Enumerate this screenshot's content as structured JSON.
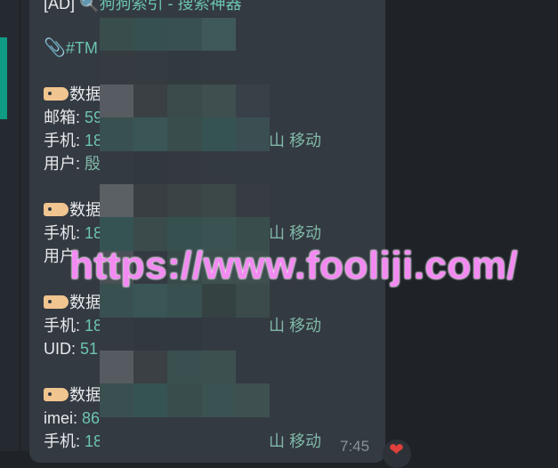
{
  "message": {
    "ad_prefix": "[AD]",
    "ad_icon": "magnifier-icon",
    "ad_link": "狗狗索引 - 搜索神器",
    "hashtag_icon": "paperclip-icon",
    "hashtag": "#TM",
    "records": [
      {
        "title": "数据",
        "rows": [
          {
            "label": "邮箱:",
            "value": "59"
          },
          {
            "label": "手机:",
            "value": "18",
            "carrier": "山 移动"
          },
          {
            "label": "用户:",
            "value": "殷"
          }
        ]
      },
      {
        "title": "数据",
        "rows": [
          {
            "label": "手机:",
            "value": "18",
            "carrier": "山 移动"
          },
          {
            "label": "用户",
            "value": ""
          }
        ]
      },
      {
        "title": "数据",
        "rows": [
          {
            "label": "手机:",
            "value": "18",
            "carrier": "山 移动"
          },
          {
            "label": "UID:",
            "value": "51"
          }
        ]
      },
      {
        "title": "数据",
        "rows": [
          {
            "label": "imei:",
            "value": "86"
          },
          {
            "label": "手机:",
            "value": "18",
            "carrier": "山 移动"
          }
        ]
      }
    ],
    "time": "7:45",
    "reaction_icon": "heart-icon"
  },
  "watermark": "https://www.fooliji.com/",
  "colors": {
    "accent": "#0f9b84",
    "link": "#6cc4b0",
    "watermark": "#f38af2",
    "bubble": "#343a41"
  },
  "blur_mosaic": [
    "#3a4d4d",
    "#365050",
    "#395050",
    "#3f5858",
    "#343a41",
    "#363b42",
    "#343c41",
    "#313a3f",
    "#333a40",
    "#343a41",
    "#565c61",
    "#3a4044",
    "#3b4b4b",
    "#3f4f4f",
    "#384048",
    "#395050",
    "#3a5555",
    "#3a4d4d",
    "#365353",
    "#3b4f53",
    "#343a41",
    "#323840",
    "#34393f",
    "#343a41",
    "#343a41",
    "#5b6064",
    "#383e42",
    "#3a4444",
    "#3c4747",
    "#363c42",
    "#365353",
    "#3b4b4b",
    "#365050",
    "#3b5252",
    "#3a4d4d",
    "#4a5055",
    "#343a41",
    "#394a4a",
    "#3e4f4f",
    "#3f4f4f",
    "#395050",
    "#3a5555",
    "#395050",
    "#344242",
    "#3b4b4b",
    "#343a41",
    "#323840",
    "#313840",
    "#343a41",
    "#343a41",
    "#555b60",
    "#3a4044",
    "#3a4f4f",
    "#3c5050",
    "#343a41",
    "#3a5050",
    "#365353",
    "#3a4d4d",
    "#3b5252",
    "#3e5050",
    "#343a41",
    "#343a41",
    "#343a41",
    "#343a41",
    "#343a41"
  ]
}
